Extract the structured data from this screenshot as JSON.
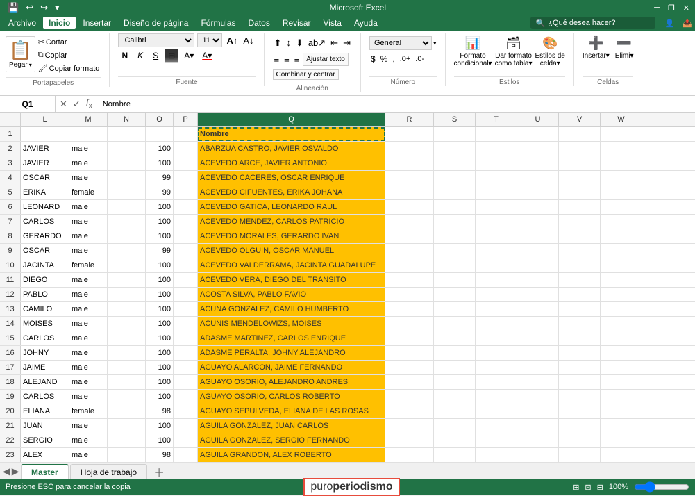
{
  "title": "Microsoft Excel",
  "menu": {
    "items": [
      "Archivo",
      "Inicio",
      "Insertar",
      "Diseño de página",
      "Fórmulas",
      "Datos",
      "Revisar",
      "Vista",
      "Ayuda"
    ],
    "active": "Inicio"
  },
  "search_placeholder": "¿Qué desea hacer?",
  "quick_access": {
    "save": "💾",
    "undo": "↩",
    "redo": "↪"
  },
  "ribbon": {
    "groups": [
      {
        "label": "Portapapeles",
        "buttons": [
          "Pegar",
          "Cortar",
          "Copiar",
          "Copiar formato"
        ]
      },
      {
        "label": "Fuente",
        "font": "Calibri",
        "size": "11"
      },
      {
        "label": "Alineación",
        "buttons": [
          "Ajustar texto",
          "Combinar y centrar"
        ]
      },
      {
        "label": "Número",
        "format": "General"
      },
      {
        "label": "Estilos",
        "buttons": [
          "Formato condicional",
          "Dar formato como tabla",
          "Estilos de celda"
        ]
      },
      {
        "label": "Celdas",
        "buttons": [
          "Insertar",
          "Eliminar"
        ]
      }
    ]
  },
  "formula_bar": {
    "cell_ref": "Q1",
    "formula": "Nombre"
  },
  "columns": [
    "L",
    "M",
    "N",
    "O",
    "P",
    "Q",
    "R",
    "S",
    "T",
    "U",
    "V",
    "W"
  ],
  "rows": [
    {
      "num": 1,
      "l": "",
      "m": "",
      "n": "",
      "o": "",
      "p": "",
      "q": "Nombre"
    },
    {
      "num": 2,
      "l": "JAVIER",
      "m": "male",
      "n": "",
      "o": "100",
      "p": "",
      "q": "ABARZUA CASTRO, JAVIER OSVALDO"
    },
    {
      "num": 3,
      "l": "JAVIER",
      "m": "male",
      "n": "",
      "o": "100",
      "p": "",
      "q": "ACEVEDO ARCE, JAVIER ANTONIO"
    },
    {
      "num": 4,
      "l": "OSCAR",
      "m": "male",
      "n": "",
      "o": "99",
      "p": "",
      "q": "ACEVEDO CACERES, OSCAR ENRIQUE"
    },
    {
      "num": 5,
      "l": "ERIKA",
      "m": "female",
      "n": "",
      "o": "99",
      "p": "",
      "q": "ACEVEDO CIFUENTES, ERIKA JOHANA"
    },
    {
      "num": 6,
      "l": "LEONARD",
      "m": "male",
      "n": "",
      "o": "100",
      "p": "",
      "q": "ACEVEDO GATICA, LEONARDO RAUL"
    },
    {
      "num": 7,
      "l": "CARLOS",
      "m": "male",
      "n": "",
      "o": "100",
      "p": "",
      "q": "ACEVEDO MENDEZ, CARLOS PATRICIO"
    },
    {
      "num": 8,
      "l": "GERARDO",
      "m": "male",
      "n": "",
      "o": "100",
      "p": "",
      "q": "ACEVEDO MORALES, GERARDO IVAN"
    },
    {
      "num": 9,
      "l": "OSCAR",
      "m": "male",
      "n": "",
      "o": "99",
      "p": "",
      "q": "ACEVEDO OLGUIN, OSCAR MANUEL"
    },
    {
      "num": 10,
      "l": "JACINTA",
      "m": "female",
      "n": "",
      "o": "100",
      "p": "",
      "q": "ACEVEDO VALDERRAMA, JACINTA GUADALUPE"
    },
    {
      "num": 11,
      "l": "DIEGO",
      "m": "male",
      "n": "",
      "o": "100",
      "p": "",
      "q": "ACEVEDO VERA, DIEGO DEL TRANSITO"
    },
    {
      "num": 12,
      "l": "PABLO",
      "m": "male",
      "n": "",
      "o": "100",
      "p": "",
      "q": "ACOSTA SILVA, PABLO FAVIO"
    },
    {
      "num": 13,
      "l": "CAMILO",
      "m": "male",
      "n": "",
      "o": "100",
      "p": "",
      "q": "ACUNA GONZALEZ, CAMILO HUMBERTO"
    },
    {
      "num": 14,
      "l": "MOISES",
      "m": "male",
      "n": "",
      "o": "100",
      "p": "",
      "q": "ACUNIS MENDELOWIZS, MOISES"
    },
    {
      "num": 15,
      "l": "CARLOS",
      "m": "male",
      "n": "",
      "o": "100",
      "p": "",
      "q": "ADASME MARTINEZ, CARLOS ENRIQUE"
    },
    {
      "num": 16,
      "l": "JOHNY",
      "m": "male",
      "n": "",
      "o": "100",
      "p": "",
      "q": "ADASME PERALTA, JOHNY ALEJANDRO"
    },
    {
      "num": 17,
      "l": "JAIME",
      "m": "male",
      "n": "",
      "o": "100",
      "p": "",
      "q": "AGUAYO ALARCON, JAIME FERNANDO"
    },
    {
      "num": 18,
      "l": "ALEJAND",
      "m": "male",
      "n": "",
      "o": "100",
      "p": "",
      "q": "AGUAYO OSORIO, ALEJANDRO ANDRES"
    },
    {
      "num": 19,
      "l": "CARLOS",
      "m": "male",
      "n": "",
      "o": "100",
      "p": "",
      "q": "AGUAYO OSORIO, CARLOS ROBERTO"
    },
    {
      "num": 20,
      "l": "ELIANA",
      "m": "female",
      "n": "",
      "o": "98",
      "p": "",
      "q": "AGUAYO SEPULVEDA, ELIANA DE LAS ROSAS"
    },
    {
      "num": 21,
      "l": "JUAN",
      "m": "male",
      "n": "",
      "o": "100",
      "p": "",
      "q": "AGUILA GONZALEZ, JUAN CARLOS"
    },
    {
      "num": 22,
      "l": "SERGIO",
      "m": "male",
      "n": "",
      "o": "100",
      "p": "",
      "q": "AGUILA GONZALEZ, SERGIO FERNANDO"
    },
    {
      "num": 23,
      "l": "ALEX",
      "m": "male",
      "n": "",
      "o": "98",
      "p": "",
      "q": "AGUILA GRANDON, ALEX ROBERTO"
    }
  ],
  "sheet_tabs": [
    "Master",
    "Hoja de trabajo"
  ],
  "active_sheet": "Master",
  "status": "Presione ESC para cancelar la copia",
  "watermark": {
    "prefix": "puro",
    "bold": "periodismo"
  }
}
